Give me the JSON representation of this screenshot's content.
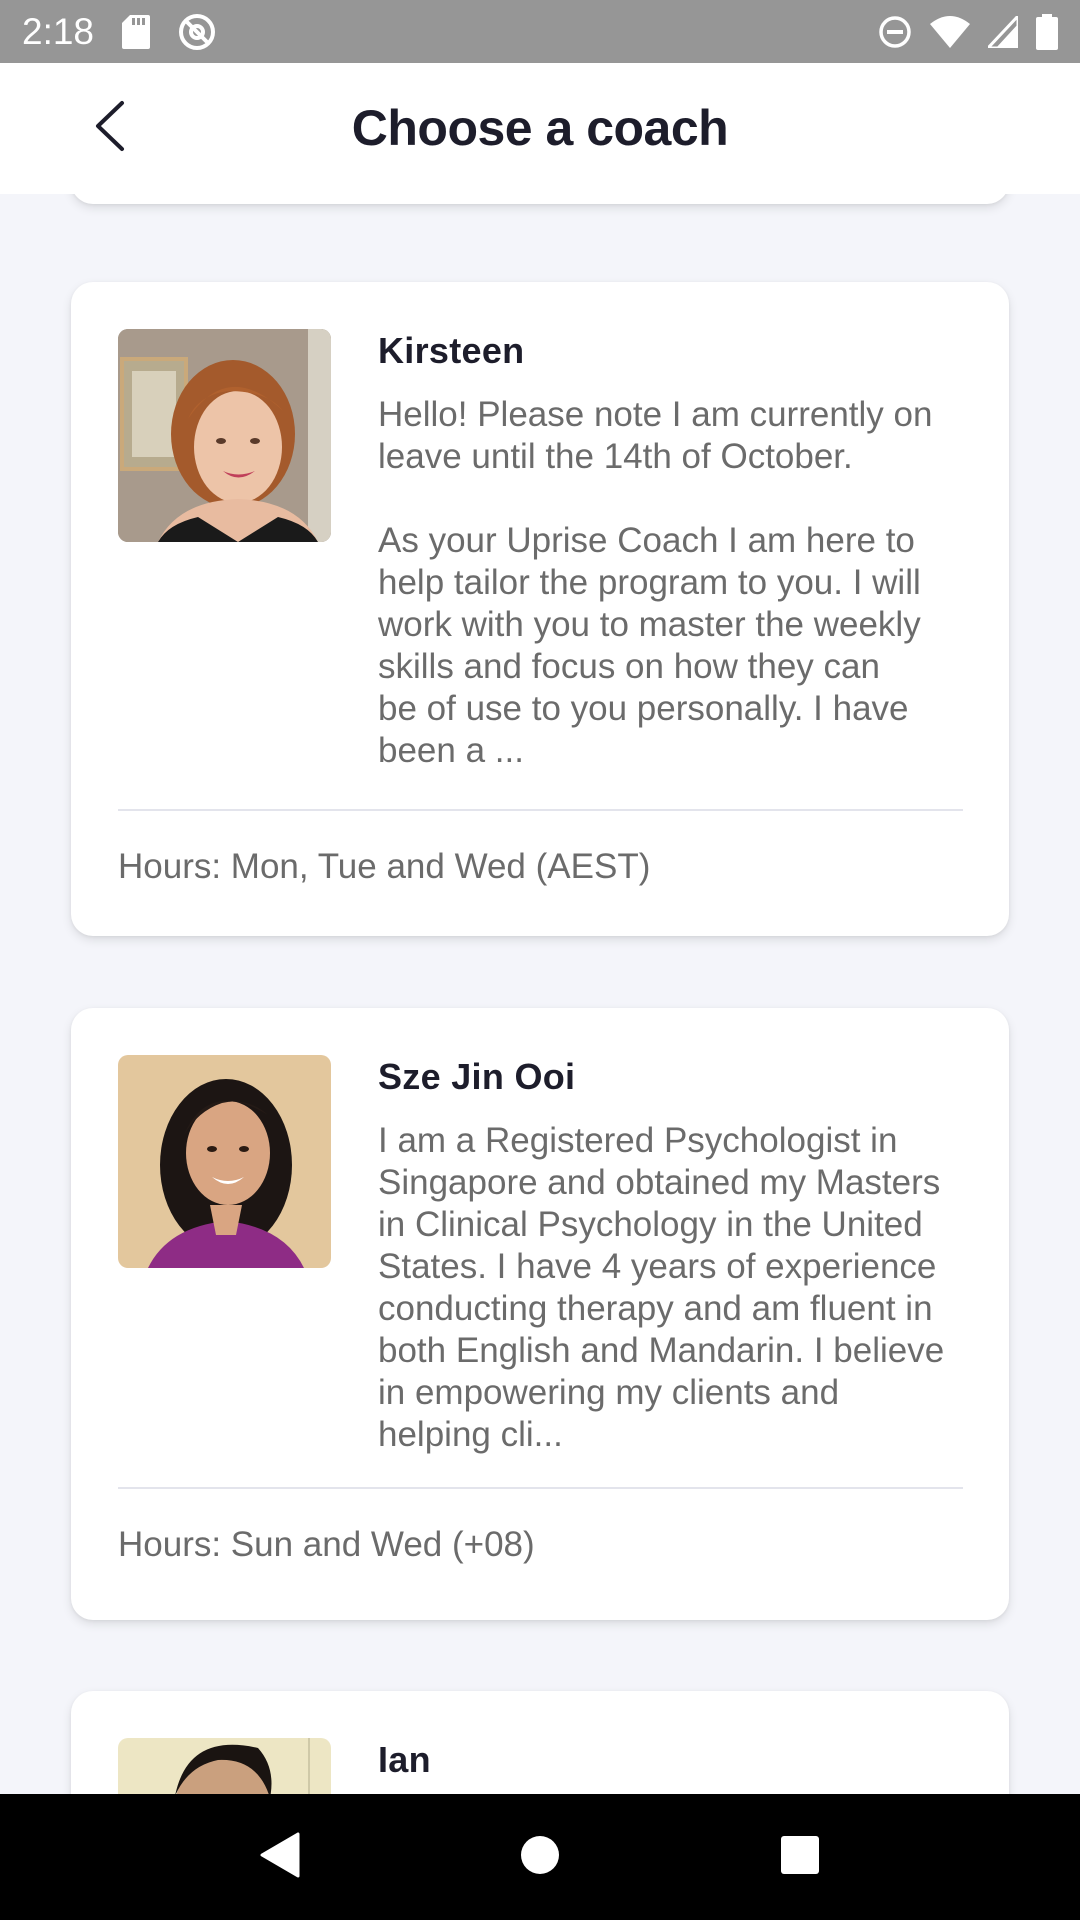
{
  "status_bar": {
    "time": "2:18",
    "icons_left": [
      "sd-card-icon",
      "at-sign-icon"
    ],
    "icons_right": [
      "do-not-disturb-icon",
      "wifi-icon",
      "signal-icon",
      "battery-icon"
    ]
  },
  "header": {
    "title": "Choose a coach",
    "back_icon": "chevron-left-icon"
  },
  "coaches": [
    {
      "name": "Kirsteen",
      "bio": "Hello! Please note I am currently on\nleave until the 14th of October.\n\nAs your Uprise Coach I am here to\nhelp tailor the program to you. I will\nwork with you to master the weekly\nskills and focus on how they can\nbe of use to you personally. I have\nbeen a ...",
      "hours": "Hours: Mon, Tue and Wed (AEST)"
    },
    {
      "name": "Sze Jin Ooi",
      "bio": "I am a Registered Psychologist in\nSingapore and obtained my Masters\nin Clinical Psychology in the United\nStates. I have 4 years of experience\nconducting therapy and am fluent in\nboth English and Mandarin. I believe\nin empowering my clients and\nhelping cli...",
      "hours": "Hours: Sun and Wed (+08)"
    },
    {
      "name": "Ian"
    }
  ],
  "nav_bar": {
    "back_icon": "triangle-back-icon",
    "home_icon": "circle-home-icon",
    "recents_icon": "square-recents-icon"
  },
  "colors": {
    "status_bar": "#969696",
    "background": "#f4f5fa",
    "card": "#ffffff",
    "title": "#1d1d2b",
    "body_text": "#6b6b6b"
  }
}
